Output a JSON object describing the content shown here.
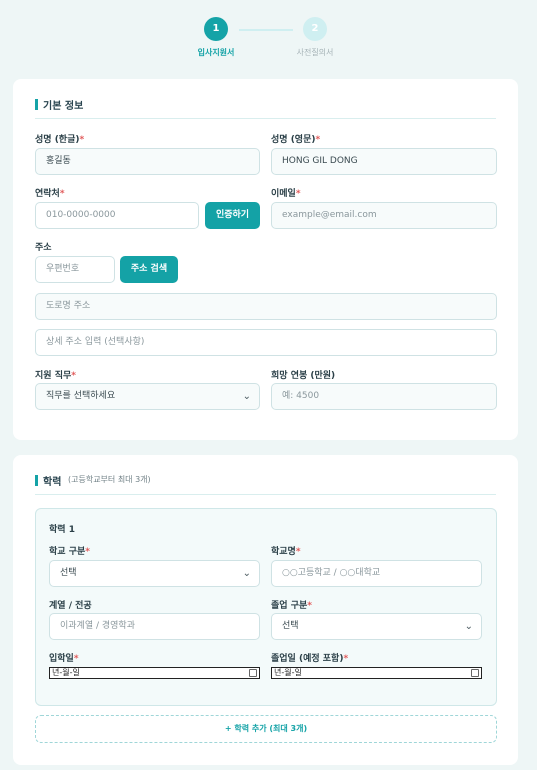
{
  "stepper": {
    "steps": [
      {
        "number": "1",
        "label": "입사지원서"
      },
      {
        "number": "2",
        "label": "사전질의서"
      }
    ]
  },
  "basic_info": {
    "title": "기본 정보",
    "name_kr": {
      "label": "성명 (한글)",
      "value": "홍길동"
    },
    "name_en": {
      "label": "성명 (영문)",
      "value": "HONG GIL DONG"
    },
    "phone": {
      "label": "연락처",
      "placeholder": "010-0000-0000",
      "verify_button": "인증하기"
    },
    "email": {
      "label": "이메일",
      "placeholder": "example@email.com"
    },
    "address": {
      "label": "주소",
      "zip_placeholder": "우편번호",
      "search_button": "주소 검색",
      "road_placeholder": "도로명 주소",
      "detail_placeholder": "상세 주소 입력 (선택사항)"
    },
    "job": {
      "label": "지원 직무",
      "selected": "직무를 선택하세요"
    },
    "salary": {
      "label": "희망 연봉 (만원)",
      "placeholder": "예: 4500"
    }
  },
  "education": {
    "title": "학력",
    "subtitle": "(고등학교부터 최대 3개)",
    "entry": {
      "title": "학력 1",
      "school_type": {
        "label": "학교 구분",
        "selected": "선택"
      },
      "school_name": {
        "label": "학교명",
        "placeholder": "○○고등학교 / ○○대학교"
      },
      "major": {
        "label": "계열 / 전공",
        "placeholder": "이과계열 / 경영학과"
      },
      "grad_type": {
        "label": "졸업 구분",
        "selected": "선택"
      },
      "entry_date": {
        "label": "입학일",
        "value": "년-월-일"
      },
      "grad_date": {
        "label": "졸업일 (예정 포함)",
        "value": "년-월-일"
      }
    },
    "add_button": "+ 학력 추가 (최대 3개)"
  },
  "required_mark": "*",
  "colors": {
    "accent": "#15a3a7",
    "required": "#e15a5a",
    "background": "#eef6f6"
  },
  "icons": {
    "select_arrow": "chevron-down-icon",
    "date_picker": "calendar-icon"
  }
}
